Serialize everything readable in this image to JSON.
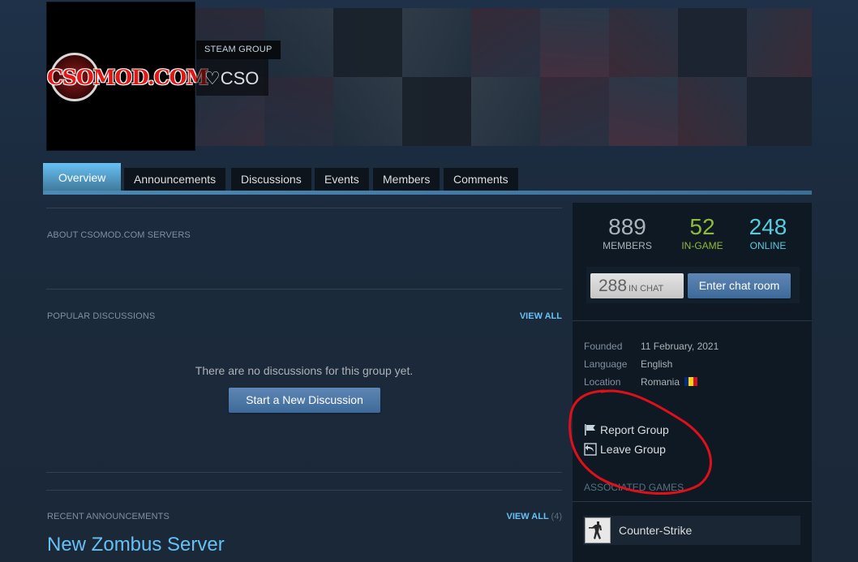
{
  "header": {
    "group_type": "STEAM GROUP",
    "group_name": "♡CSO",
    "avatar_text": "CSOMOD.COM"
  },
  "tabs": [
    {
      "label": "Overview",
      "active": true
    },
    {
      "label": "Announcements",
      "active": false
    },
    {
      "label": "Discussions",
      "active": false
    },
    {
      "label": "Events",
      "active": false
    },
    {
      "label": "Members",
      "active": false
    },
    {
      "label": "Comments",
      "active": false
    }
  ],
  "main": {
    "about_header": "ABOUT CSOMOD.COM SERVERS",
    "popular": {
      "header": "POPULAR DISCUSSIONS",
      "view_all": "VIEW ALL",
      "empty_message": "There are no discussions for this group yet.",
      "start_button": "Start a New Discussion"
    },
    "announcements": {
      "header": "RECENT ANNOUNCEMENTS",
      "view_all": "VIEW ALL",
      "count": "(4)",
      "latest_title": "New Zombus Server"
    }
  },
  "sidebar": {
    "stats": {
      "members": {
        "value": "889",
        "label": "MEMBERS",
        "color": "#acb2b8"
      },
      "in_game": {
        "value": "52",
        "label": "IN-GAME",
        "color": "#90ba3c"
      },
      "online": {
        "value": "248",
        "label": "ONLINE",
        "color": "#57cbde"
      }
    },
    "chat": {
      "count": "288",
      "count_label": "IN CHAT",
      "enter_button": "Enter chat room"
    },
    "info": [
      {
        "label": "Founded",
        "value": "11 February, 2021"
      },
      {
        "label": "Language",
        "value": "English"
      },
      {
        "label": "Location",
        "value": "Romania"
      }
    ],
    "actions": {
      "report": "Report Group",
      "leave": "Leave Group"
    },
    "associated_games_header": "ASSOCIATED GAMES",
    "games": [
      {
        "name": "Counter-Strike"
      }
    ]
  },
  "colors": {
    "accent": "#66c0f4",
    "annotation": "#e0101a"
  }
}
